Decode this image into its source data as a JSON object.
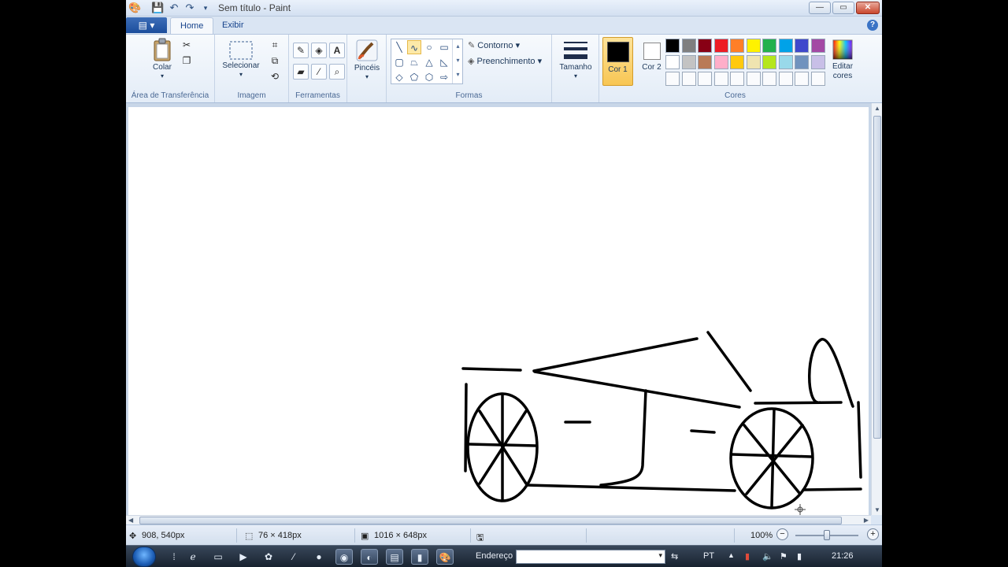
{
  "window": {
    "title": "Sem título - Paint",
    "controls": {
      "minimize": "—",
      "maximize": "▭",
      "close": "✕"
    }
  },
  "quick_access": {
    "icons": [
      "paint-app-icon",
      "save-icon",
      "undo-icon",
      "redo-icon",
      "customize-dropdown-icon"
    ]
  },
  "tabs": {
    "home": "Home",
    "view": "Exibir",
    "help_symbol": "?"
  },
  "ribbon": {
    "clipboard": {
      "label": "Área de Transferência",
      "paste": "Colar"
    },
    "image": {
      "label": "Imagem",
      "select": "Selecionar"
    },
    "tools": {
      "label": "Ferramentas"
    },
    "brushes": {
      "label": "Pincéis"
    },
    "shapes": {
      "label": "Formas",
      "outline": "Contorno",
      "fill": "Preenchimento"
    },
    "size": {
      "label": "Tamanho"
    },
    "colors": {
      "label": "Cores",
      "color1": "Cor 1",
      "color2": "Cor 2",
      "edit": "Editar cores",
      "color1_value": "#000000",
      "color2_value": "#ffffff",
      "palette_row1": [
        "#000000",
        "#7f7f7f",
        "#880015",
        "#ed1c24",
        "#ff7f27",
        "#fff200",
        "#22b14c",
        "#00a2e8",
        "#3f48cc",
        "#a349a4"
      ],
      "palette_row2": [
        "#ffffff",
        "#c3c3c3",
        "#b97a57",
        "#ffaec9",
        "#ffc90e",
        "#efe4b0",
        "#b5e61d",
        "#99d9ea",
        "#7092be",
        "#c8bfe7"
      ]
    }
  },
  "status": {
    "cursor_pos": "908, 540px",
    "selection_size": "76 × 418px",
    "image_size": "1016 × 648px",
    "zoom": "100%"
  },
  "taskbar": {
    "address_label": "Endereço",
    "lang": "PT",
    "time": "21:26"
  }
}
